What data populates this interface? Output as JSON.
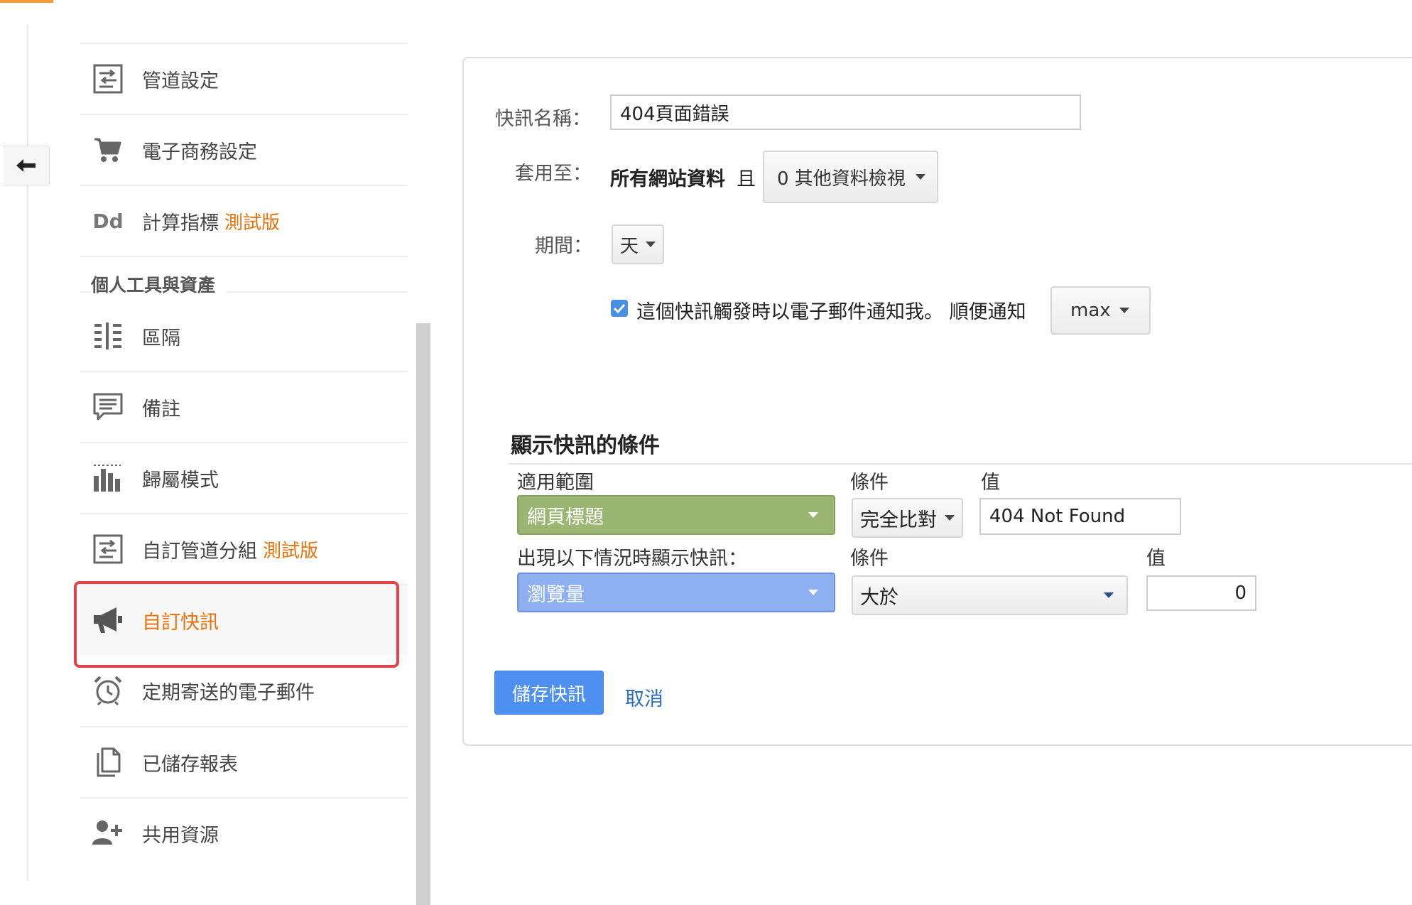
{
  "colors": {
    "accent": "#f29c38",
    "active_text": "#e8710a",
    "highlight_frame": "#e2424a",
    "dimension_green": "#9bb572",
    "metric_blue": "#8fb0f0",
    "primary_button": "#4d90f0",
    "link": "#2a6ebb"
  },
  "sidebar": {
    "items_top": [
      {
        "icon": "channel-settings-icon",
        "label": "管道設定",
        "beta": ""
      },
      {
        "icon": "cart-icon",
        "label": "電子商務設定",
        "beta": ""
      },
      {
        "icon": "dd-icon",
        "icon_text": "Dd",
        "label": "計算指標",
        "beta": "測試版"
      }
    ],
    "section_title": "個人工具與資產",
    "items_personal": [
      {
        "icon": "segments-icon",
        "label": "區隔",
        "beta": ""
      },
      {
        "icon": "annotations-icon",
        "label": "備註",
        "beta": ""
      },
      {
        "icon": "attribution-icon",
        "label": "歸屬模式",
        "beta": ""
      },
      {
        "icon": "channel-grouping-icon",
        "label": "自訂管道分組",
        "beta": "測試版"
      },
      {
        "icon": "megaphone-icon",
        "label": "自訂快訊",
        "beta": "",
        "active": true
      },
      {
        "icon": "alarm-clock-icon",
        "label": "定期寄送的電子郵件",
        "beta": ""
      },
      {
        "icon": "saved-reports-icon",
        "label": "已儲存報表",
        "beta": ""
      },
      {
        "icon": "add-person-icon",
        "label": "共用資源",
        "beta": ""
      }
    ]
  },
  "form": {
    "name_label": "快訊名稱：",
    "name_value": "404頁面錯誤",
    "apply_label": "套用至：",
    "apply_text": "所有網站資料",
    "apply_conj": "且",
    "apply_select": "0 其他資料檢視",
    "period_label": "期間：",
    "period_value": "天",
    "email_checked": true,
    "email_text": "這個快訊觸發時以電子郵件通知我。 順便通知",
    "email_select": "max"
  },
  "conditions": {
    "title": "顯示快訊的條件",
    "scope_label": "適用範圍",
    "condition_label": "條件",
    "value_label": "值",
    "dimension": "網頁標題",
    "dimension_condition": "完全比對",
    "dimension_value": "404 Not Found",
    "trigger_label": "出現以下情況時顯示快訊：",
    "trigger_condition_label": "條件",
    "trigger_value_label": "值",
    "metric": "瀏覽量",
    "metric_condition": "大於",
    "metric_value": "0"
  },
  "actions": {
    "save_label": "儲存快訊",
    "cancel_label": "取消"
  }
}
